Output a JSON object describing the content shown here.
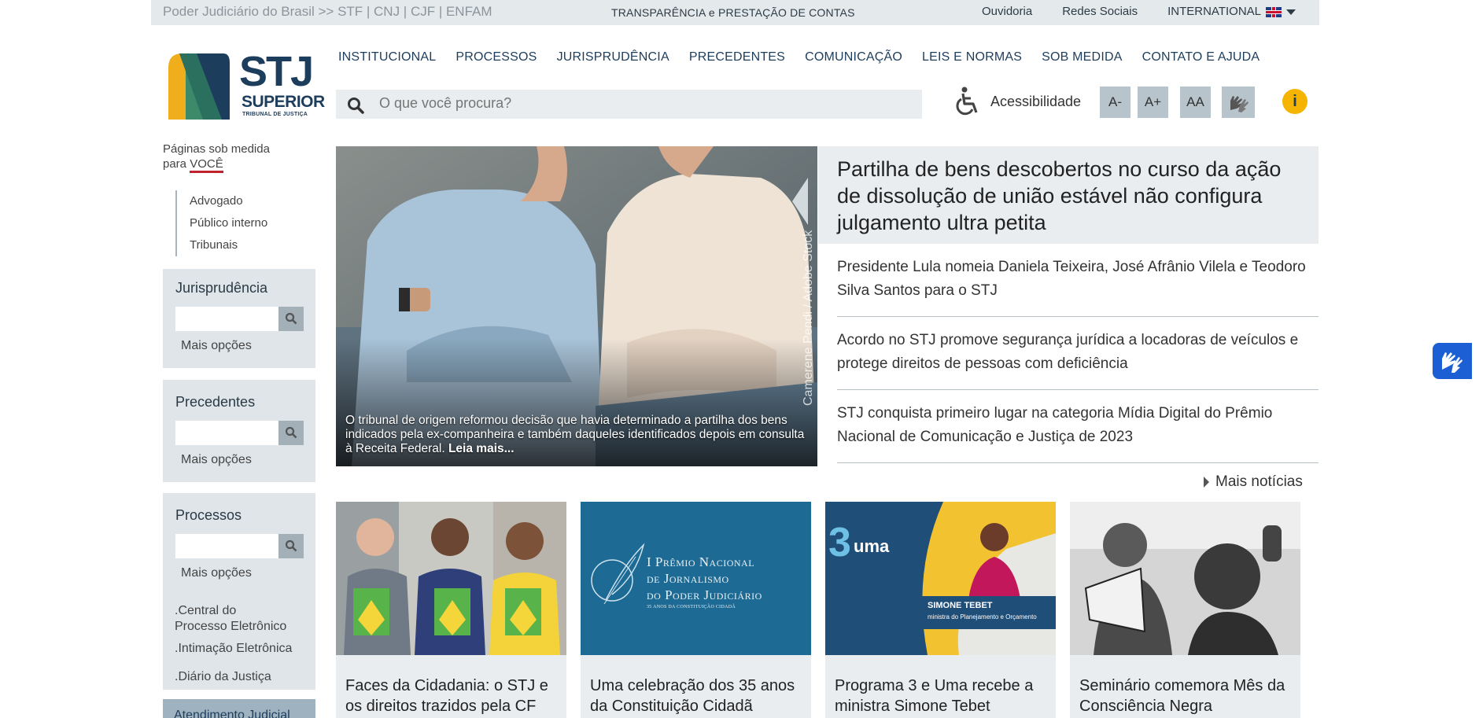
{
  "topbar": {
    "left": "Poder Judiciário do Brasil >> STF | CNJ | CJF | ENFAM",
    "center": "TRANSPARÊNCIA e PRESTAÇÃO DE CONTAS",
    "ouvidoria": "Ouvidoria",
    "redes": "Redes Sociais",
    "international": "INTERNATIONAL"
  },
  "logo": {
    "stj": "STJ",
    "superior": "SUPERIOR",
    "tribunal": "TRIBUNAL DE JUSTIÇA"
  },
  "nav": [
    "INSTITUCIONAL",
    "PROCESSOS",
    "JURISPRUDÊNCIA",
    "PRECEDENTES",
    "COMUNICAÇÃO",
    "LEIS E NORMAS",
    "SOB MEDIDA",
    "CONTATO E AJUDA"
  ],
  "search": {
    "placeholder": "O que você procura?"
  },
  "accessibility": {
    "label": "Acessibilidade",
    "dec": "A-",
    "inc": "A+",
    "contrast": "AA"
  },
  "sidebar": {
    "pages_line1": "Páginas sob medida",
    "pages_line2": "para ",
    "voce": "VOCÊ",
    "audience": [
      "Advogado",
      "Público interno",
      "Tribunais"
    ],
    "boxes": [
      {
        "title": "Jurisprudência",
        "more": "Mais opções"
      },
      {
        "title": "Precedentes",
        "more": "Mais opções"
      },
      {
        "title": "Processos",
        "more": "Mais opções"
      }
    ],
    "links": [
      ".Central do Processo Eletrônico",
      ".Intimação Eletrônica",
      ".Diário da Justiça"
    ],
    "atendimento": "Atendimento Judicial"
  },
  "hero": {
    "caption": "O tribunal de origem reformou decisão que havia determinado a partilha dos bens indicados pela ex-companheira e também daqueles identificados depois em consulta à Receita Federal.",
    "readmore": "Leia mais...",
    "credit": "Camerene Pendi / Adobe Stock"
  },
  "headline": "Partilha de bens descobertos no curso da ação de dissolução de união estável não configura julgamento ultra petita",
  "news": [
    "Presidente Lula nomeia Daniela Teixeira, José Afrânio Vilela e Teodoro Silva Santos para o STJ",
    "Acordo no STJ promove segurança jurídica a locadoras de veículos e protege direitos de pessoas com deficiência",
    "STJ conquista primeiro lugar na categoria Mídia Digital do Prêmio Nacional de Comunicação e Justiça de 2023"
  ],
  "mais_noticias": "Mais notícias",
  "cards": [
    {
      "title": "Faces da Cidadania: o STJ e os direitos trazidos pela CF"
    },
    {
      "title": "Uma celebração dos 35 anos da Constituição Cidadã",
      "img_text1": "I Prêmio Nacional",
      "img_text2": "de Jornalismo",
      "img_text3": "do Poder Judiciário",
      "img_text4": "35 ANOS DA CONSTITUIÇÃO CIDADÃ"
    },
    {
      "title": "Programa 3 e Uma recebe a ministra Simone Tebet",
      "img_logo": "3",
      "img_logo2": "uma",
      "img_name": "SIMONE TEBET",
      "img_role": "ministra do Planejamento e Orçamento"
    },
    {
      "title": "Seminário comemora Mês da Consciência Negra"
    }
  ],
  "colors": {
    "navy": "#1d3d5c",
    "panel": "#e9edf0",
    "accent_red": "#c0232c",
    "info_yellow": "#f4b400",
    "vlibras_blue": "#1c5fd4"
  }
}
